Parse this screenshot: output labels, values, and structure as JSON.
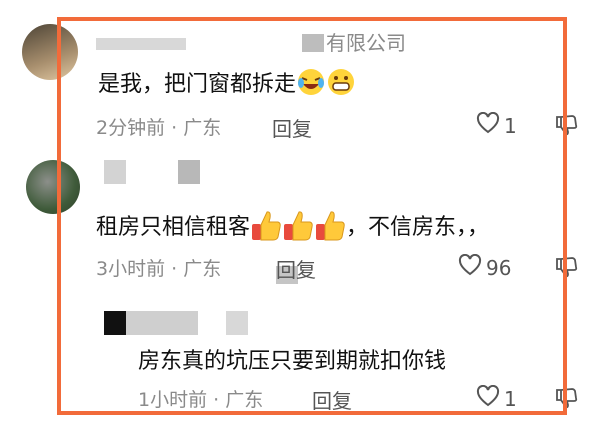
{
  "top_partial": {
    "company": "有限公司"
  },
  "comments": [
    {
      "text": "是我，把门窗都拆走",
      "time": "2分钟前",
      "location": "广东",
      "reply": "回复",
      "likes": "1"
    },
    {
      "text_a": "租房只相信租客",
      "text_b": "，不信房东，，",
      "time": "3小时前",
      "location": "广东",
      "reply": "回复",
      "likes": "96"
    },
    {
      "text": "房东真的坑压只要到期就扣你钱",
      "time": "1小时前",
      "location": "广东",
      "reply": "回复",
      "likes": "1"
    }
  ],
  "separator": "·",
  "colors": {
    "frame": "#f26b3a",
    "meta": "#8a8a8a"
  }
}
